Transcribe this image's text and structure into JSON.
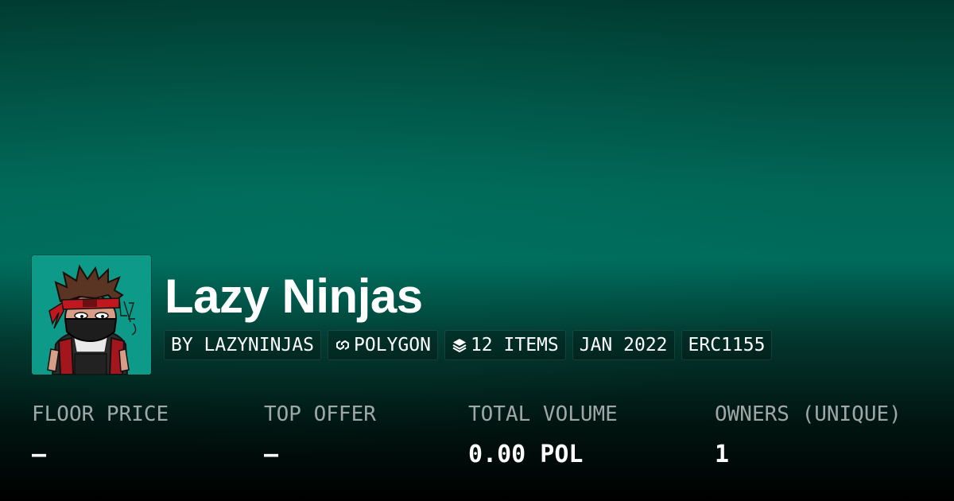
{
  "collection": {
    "name": "Lazy Ninjas",
    "avatar_alt": "lazy ninja character artwork",
    "avatar_signature": "Lazy Ninjas"
  },
  "tags": [
    {
      "label": "BY LAZYNINJAS",
      "icon": ""
    },
    {
      "label": "POLYGON",
      "icon": "polygon-chain-icon"
    },
    {
      "label": "12 ITEMS",
      "icon": "layers-icon"
    },
    {
      "label": "JAN 2022",
      "icon": ""
    },
    {
      "label": "ERC1155",
      "icon": ""
    }
  ],
  "stats": [
    {
      "label": "FLOOR PRICE",
      "value": "—"
    },
    {
      "label": "TOP OFFER",
      "value": "—"
    },
    {
      "label": "TOTAL VOLUME",
      "value": "0.00 POL"
    },
    {
      "label": "OWNERS (UNIQUE)",
      "value": "1"
    }
  ],
  "colors": {
    "background_top": "#013a30",
    "background_mid": "#006b5b",
    "background_bottom": "#000000",
    "avatar_background": "#0e9a88",
    "headband": "#c0181f"
  }
}
